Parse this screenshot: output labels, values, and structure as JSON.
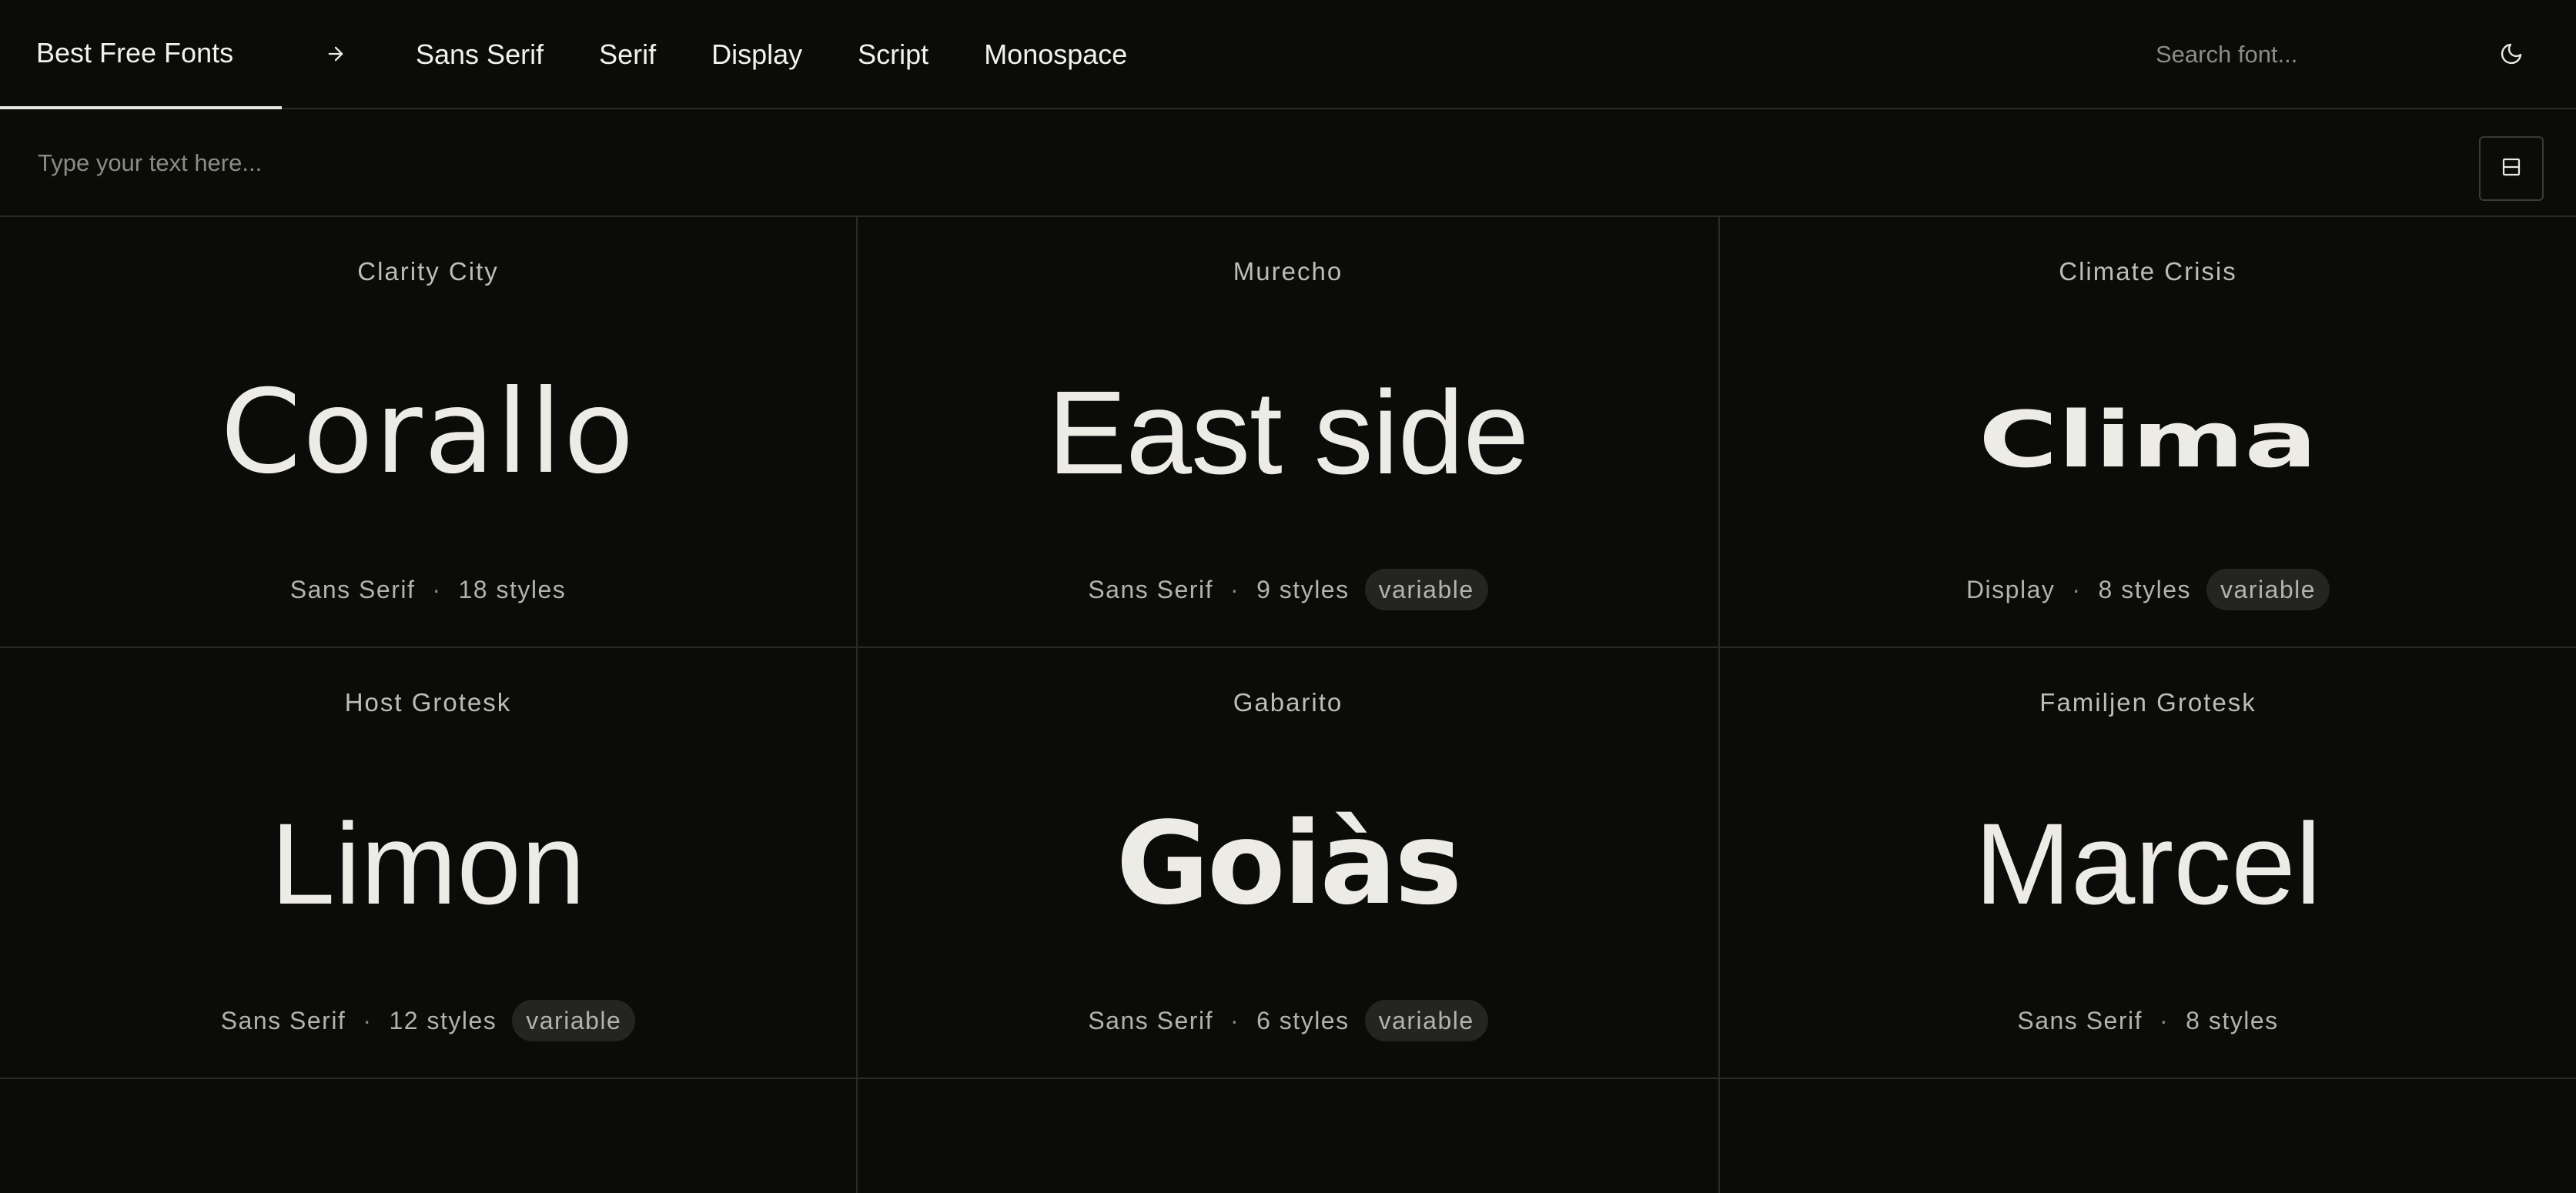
{
  "nav": {
    "brand": "Best Free Fonts",
    "links": [
      "Sans Serif",
      "Serif",
      "Display",
      "Script",
      "Monospace"
    ],
    "search_placeholder": "Search font..."
  },
  "preview": {
    "placeholder": "Type your text here..."
  },
  "fonts": [
    {
      "name": "Clarity City",
      "sample": "Corallo",
      "category": "Sans Serif",
      "styles": "18 styles",
      "badge": ""
    },
    {
      "name": "Murecho",
      "sample": "East side",
      "category": "Sans Serif",
      "styles": "9 styles",
      "badge": "variable"
    },
    {
      "name": "Climate Crisis",
      "sample": "Clima",
      "category": "Display",
      "styles": "8 styles",
      "badge": "variable"
    },
    {
      "name": "Host Grotesk",
      "sample": "Limon",
      "category": "Sans Serif",
      "styles": "12 styles",
      "badge": "variable"
    },
    {
      "name": "Gabarito",
      "sample": "Goiàs",
      "category": "Sans Serif",
      "styles": "6 styles",
      "badge": "variable"
    },
    {
      "name": "Familjen Grotesk",
      "sample": "Marcel",
      "category": "Sans Serif",
      "styles": "8 styles",
      "badge": ""
    }
  ],
  "meta_separator": "·",
  "icons": {
    "arrow": "arrow-right-icon",
    "theme": "moon-icon",
    "layout": "layout-rows-icon"
  },
  "colors": {
    "background": "#0b0b0a",
    "text": "#e9e8e3",
    "muted": "#b3b2ac",
    "border": "#2a2a28",
    "badge_bg": "#242422"
  }
}
